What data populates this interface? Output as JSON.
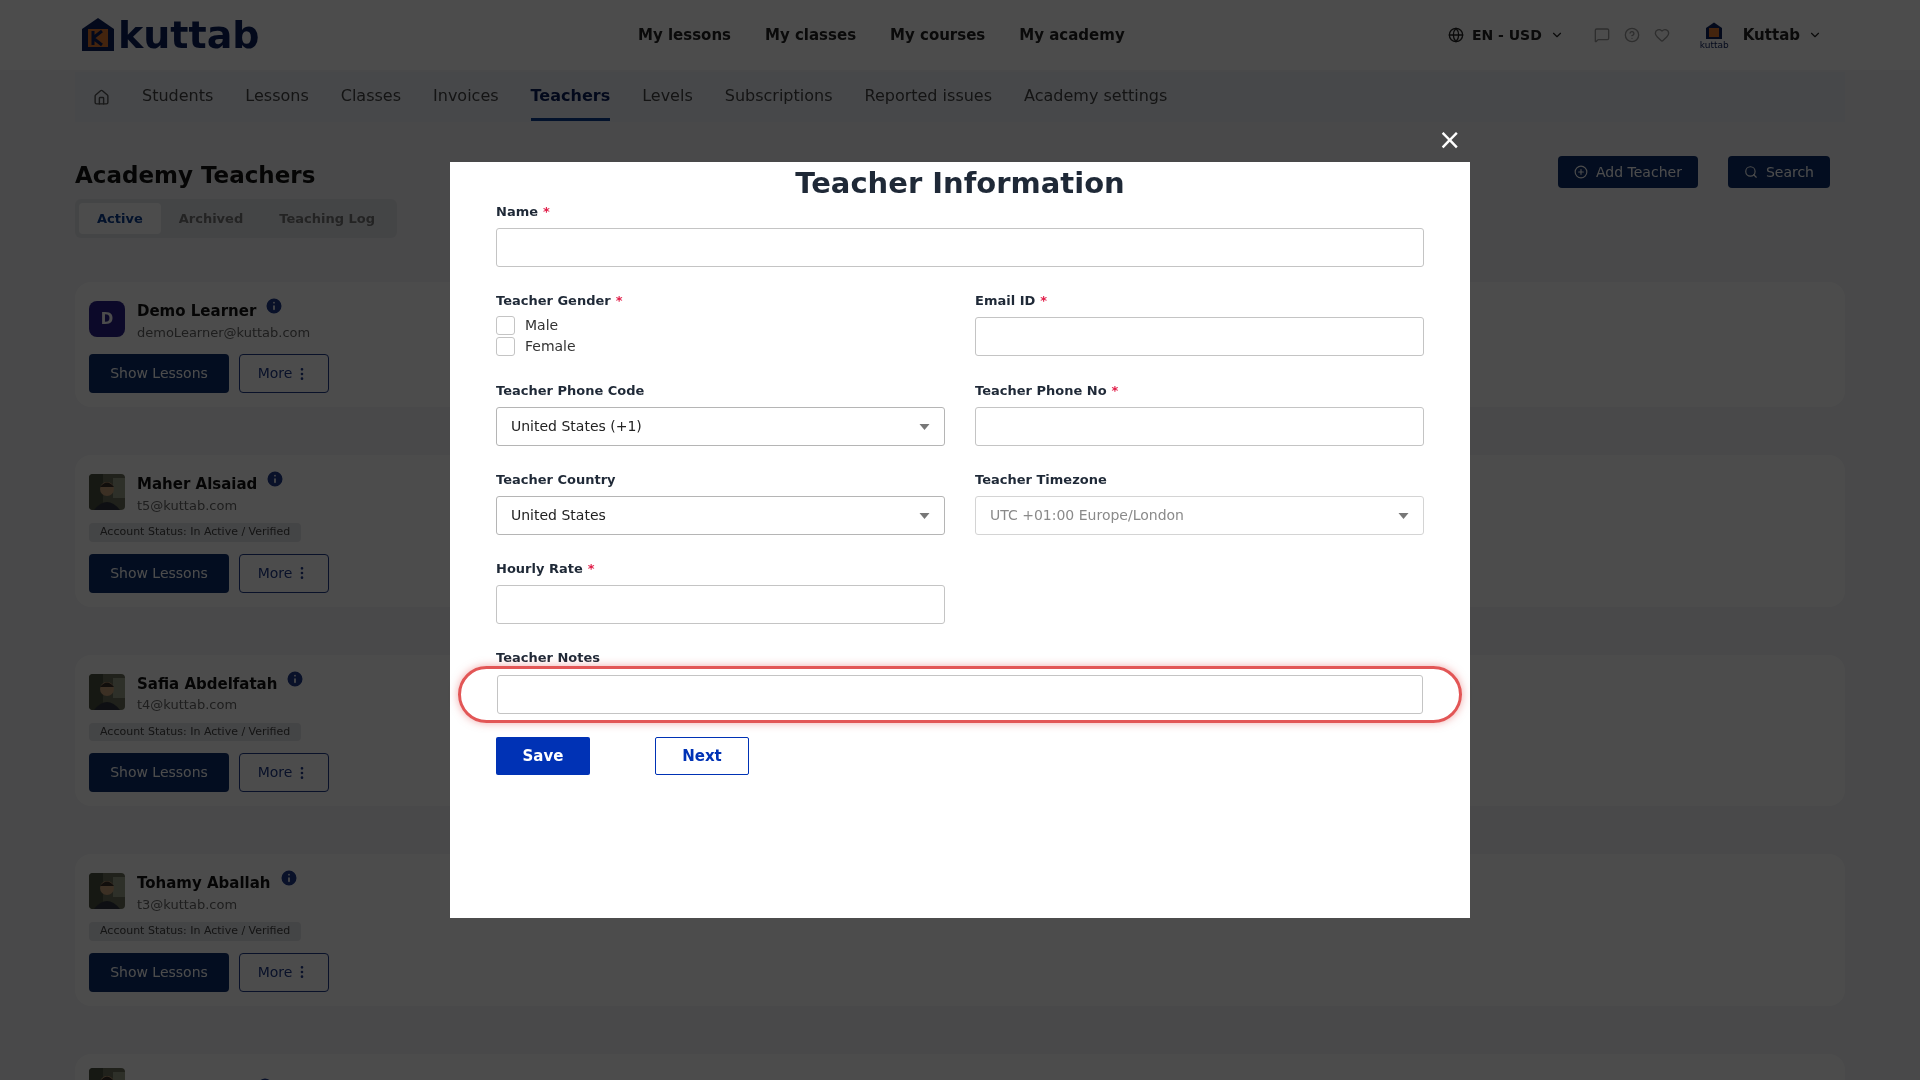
{
  "header": {
    "logo": "kuttab",
    "menu": [
      "My lessons",
      "My classes",
      "My courses",
      "My academy"
    ],
    "locale": "EN - USD",
    "user": {
      "logo_caption": "kuttab",
      "name": "Kuttab"
    }
  },
  "nav": [
    {
      "label": "Students",
      "selected": false
    },
    {
      "label": "Lessons",
      "selected": false
    },
    {
      "label": "Classes",
      "selected": false
    },
    {
      "label": "Invoices",
      "selected": false
    },
    {
      "label": "Teachers",
      "selected": true
    },
    {
      "label": "Levels",
      "selected": false
    },
    {
      "label": "Subscriptions",
      "selected": false
    },
    {
      "label": "Reported issues",
      "selected": false
    },
    {
      "label": "Academy settings",
      "selected": false
    }
  ],
  "page": {
    "title": "Academy Teachers",
    "tabs": [
      {
        "label": "Active",
        "selected": true
      },
      {
        "label": "Archived",
        "selected": false
      },
      {
        "label": "Teaching Log",
        "selected": false
      }
    ],
    "actions": [
      "Add Teacher",
      "Search"
    ]
  },
  "teachers": [
    {
      "name": "Demo Learner",
      "email": "demoLearner@kuttab.com",
      "avatar": {
        "kind": "initial",
        "text": "D"
      },
      "show_lessons": "Show Lessons",
      "more": "More"
    },
    {
      "name": "Maher Alsaiad",
      "email": "t5@kuttab.com",
      "avatar": {
        "kind": "picture"
      },
      "status": "Account Status: In Active / Verified",
      "show_lessons": "Show Lessons",
      "more": "More"
    },
    {
      "name": "Safia Abdelfatah",
      "email": "t4@kuttab.com",
      "avatar": {
        "kind": "picture"
      },
      "status": "Account Status: In Active / Verified",
      "show_lessons": "Show Lessons",
      "more": "More"
    },
    {
      "name": "Tohamy Aballah",
      "email": "t3@kuttab.com",
      "avatar": {
        "kind": "picture"
      },
      "status": "Account Status: In Active / Verified",
      "show_lessons": "Show Lessons",
      "more": "More"
    },
    {
      "avatar": {
        "kind": "picture"
      }
    }
  ],
  "modal": {
    "title": "Teacher Information",
    "close": "×",
    "fields": [
      {
        "kind": "text",
        "label": "Name",
        "required_mark": "*",
        "wide": true
      },
      {
        "kind": "checkboxes",
        "label": "Teacher Gender",
        "required_mark": "*",
        "options": [
          {
            "label": "Male",
            "checked": false
          },
          {
            "label": "Female",
            "checked": false
          }
        ]
      },
      {
        "kind": "text",
        "label": "Email ID",
        "required_mark": "*"
      },
      {
        "kind": "select",
        "label": "Teacher Phone Code",
        "value": "United States (+1)"
      },
      {
        "kind": "text",
        "label": "Teacher Phone No",
        "required_mark": "*"
      },
      {
        "kind": "select",
        "label": "Teacher Country",
        "value": "United States"
      },
      {
        "kind": "select",
        "label": "Teacher Timezone",
        "value": "UTC +01:00 Europe/London",
        "disabled": true
      },
      {
        "kind": "text",
        "label": "Hourly Rate",
        "required_mark": "*"
      },
      {
        "kind": "text",
        "label": "Teacher Notes",
        "wide": true,
        "highlighted": true
      }
    ],
    "buttons": [
      "Save",
      "Next"
    ]
  }
}
